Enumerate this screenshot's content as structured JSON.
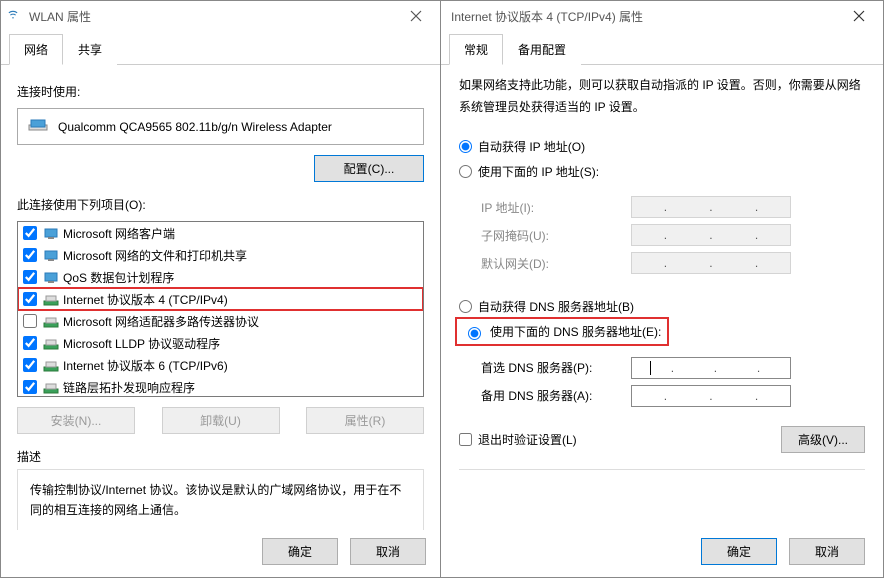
{
  "left": {
    "title": "WLAN 属性",
    "tabs": [
      "网络",
      "共享"
    ],
    "active_tab": 0,
    "connect_using_label": "连接时使用:",
    "adapter": "Qualcomm QCA9565 802.11b/g/n Wireless Adapter",
    "configure_btn": "配置(C)...",
    "items_label": "此连接使用下列项目(O):",
    "items": [
      {
        "checked": true,
        "icon": "client",
        "label": "Microsoft 网络客户端"
      },
      {
        "checked": true,
        "icon": "client",
        "label": "Microsoft 网络的文件和打印机共享"
      },
      {
        "checked": true,
        "icon": "client",
        "label": "QoS 数据包计划程序"
      },
      {
        "checked": true,
        "icon": "proto",
        "label": "Internet 协议版本 4 (TCP/IPv4)",
        "highlight": true
      },
      {
        "checked": false,
        "icon": "proto",
        "label": "Microsoft 网络适配器多路传送器协议"
      },
      {
        "checked": true,
        "icon": "proto",
        "label": "Microsoft LLDP 协议驱动程序"
      },
      {
        "checked": true,
        "icon": "proto",
        "label": "Internet 协议版本 6 (TCP/IPv6)"
      },
      {
        "checked": true,
        "icon": "proto",
        "label": "链路层拓扑发现响应程序"
      }
    ],
    "install_btn": "安装(N)...",
    "uninstall_btn": "卸载(U)",
    "properties_btn": "属性(R)",
    "desc_title": "描述",
    "desc": "传输控制协议/Internet 协议。该协议是默认的广域网络协议，用于在不同的相互连接的网络上通信。",
    "ok": "确定",
    "cancel": "取消"
  },
  "right": {
    "title": "Internet 协议版本 4 (TCP/IPv4) 属性",
    "tabs": [
      "常规",
      "备用配置"
    ],
    "active_tab": 0,
    "help": "如果网络支持此功能，则可以获取自动指派的 IP 设置。否则，你需要从网络系统管理员处获得适当的 IP 设置。",
    "ip_auto": "自动获得 IP 地址(O)",
    "ip_manual": "使用下面的 IP 地址(S):",
    "ip_selected": "auto",
    "ip_addr_label": "IP 地址(I):",
    "subnet_label": "子网掩码(U):",
    "gateway_label": "默认网关(D):",
    "dns_auto": "自动获得 DNS 服务器地址(B)",
    "dns_manual": "使用下面的 DNS 服务器地址(E):",
    "dns_selected": "manual",
    "dns1_label": "首选 DNS 服务器(P):",
    "dns2_label": "备用 DNS 服务器(A):",
    "exit_validate": "退出时验证设置(L)",
    "advanced_btn": "高级(V)...",
    "ok": "确定",
    "cancel": "取消"
  }
}
